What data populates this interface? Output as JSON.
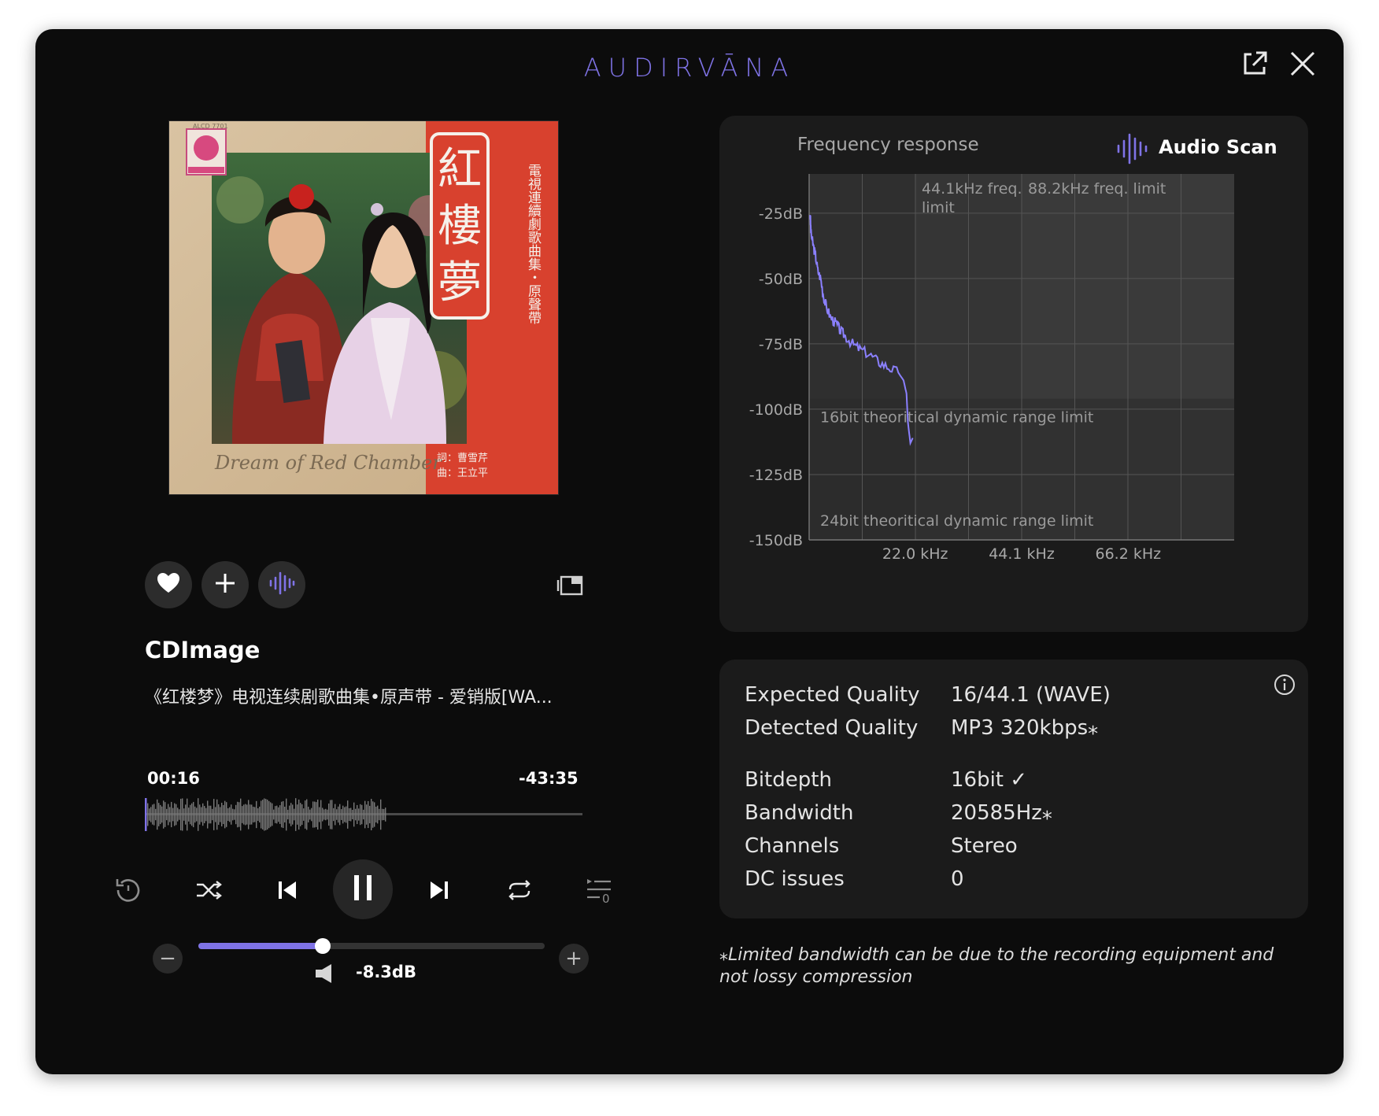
{
  "app": {
    "brand": "AUDIRVĀNA"
  },
  "colors": {
    "accent": "#7f73e6",
    "window_bg": "#0c0c0c",
    "panel_bg": "#1b1b1b",
    "plot_bg": "#3a3a3a"
  },
  "window_controls": {
    "popout_icon": "external-link-icon",
    "close_icon": "close-icon"
  },
  "album": {
    "catalog": "ALCD 7701",
    "title_vertical": [
      "紅",
      "樓",
      "夢"
    ],
    "side_text": "電視連續劇歌曲集・原聲帶",
    "script_text": "Dream of Red Chamber",
    "credits": [
      "詞：曹雪芹",
      "曲：王立平"
    ]
  },
  "actions": {
    "favorite_icon": "heart-icon",
    "add_icon": "plus-icon",
    "scan_icon": "audio-scan-icon",
    "miniplayer_icon": "mini-player-icon"
  },
  "track": {
    "title": "CDImage",
    "subtitle": "《红楼梦》电视连续剧歌曲集•原声带 - 爱销版[WA...",
    "elapsed": "00:16",
    "remaining": "-43:35",
    "progress": 0.55
  },
  "transport": {
    "replay_icon": "replay-icon",
    "shuffle_icon": "shuffle-icon",
    "previous_icon": "skip-previous-icon",
    "pause_icon": "pause-icon",
    "next_icon": "skip-next-icon",
    "repeat_icon": "repeat-icon",
    "queue_icon": "queue-icon",
    "queue_count": "0"
  },
  "volume": {
    "minus": "−",
    "plus": "+",
    "speaker_icon": "speaker-icon",
    "level": 0.36,
    "label": "-8.3dB"
  },
  "frequency_panel": {
    "title": "Frequency response",
    "scan_label": "Audio Scan"
  },
  "chart_data": {
    "type": "line",
    "title": "Frequency response",
    "x_unit": "kHz",
    "xlim": [
      0,
      88.2
    ],
    "x_ticks": [
      22.0,
      44.1,
      66.2
    ],
    "x_tick_labels": [
      "22.0 kHz",
      "44.1 kHz",
      "66.2 kHz"
    ],
    "ylim": [
      -150,
      -10
    ],
    "y_ticks": [
      -25,
      -50,
      -75,
      -100,
      -125,
      -150
    ],
    "y_tick_labels": [
      "-25dB",
      "-50dB",
      "-75dB",
      "-100dB",
      "-125dB",
      "-150dB"
    ],
    "grid": true,
    "annotations": [
      {
        "text": "44.1kHz freq. limit",
        "at_khz": 22.05
      },
      {
        "text": "88.2kHz freq. limit",
        "at_khz": 44.1
      },
      {
        "text": "16bit theoritical dynamic range limit",
        "at_db": -96
      },
      {
        "text": "24bit theoritical dynamic range limit",
        "at_db": -144
      }
    ],
    "series": [
      {
        "color": "#8b80ff",
        "points": [
          [
            0.2,
            -25
          ],
          [
            0.4,
            -33
          ],
          [
            0.8,
            -37
          ],
          [
            1.3,
            -41
          ],
          [
            1.8,
            -47
          ],
          [
            2.4,
            -50
          ],
          [
            3.0,
            -57
          ],
          [
            3.6,
            -61
          ],
          [
            4.5,
            -65
          ],
          [
            5.5,
            -67
          ],
          [
            6.5,
            -70
          ],
          [
            7.5,
            -72
          ],
          [
            9.0,
            -75
          ],
          [
            10.5,
            -77
          ],
          [
            12.5,
            -79
          ],
          [
            14.5,
            -82
          ],
          [
            16.5,
            -84
          ],
          [
            18.5,
            -86
          ],
          [
            19.6,
            -89
          ],
          [
            20.2,
            -94
          ],
          [
            20.5,
            -105
          ],
          [
            21.0,
            -113
          ],
          [
            21.5,
            -111
          ]
        ]
      }
    ]
  },
  "quality": {
    "info_icon": "info-icon",
    "rows": [
      {
        "label": "Expected Quality",
        "value": "16/44.1 (WAVE)"
      },
      {
        "label": "Detected Quality",
        "value": "MP3 320kbps⁎"
      },
      {
        "label": "Bitdepth",
        "value": "16bit ✓"
      },
      {
        "label": "Bandwidth",
        "value": "20585Hz⁎"
      },
      {
        "label": "Channels",
        "value": "Stereo"
      },
      {
        "label": "DC issues",
        "value": "0"
      }
    ]
  },
  "footnote": "⁎Limited bandwidth can be due to the recording equipment and not lossy compression"
}
